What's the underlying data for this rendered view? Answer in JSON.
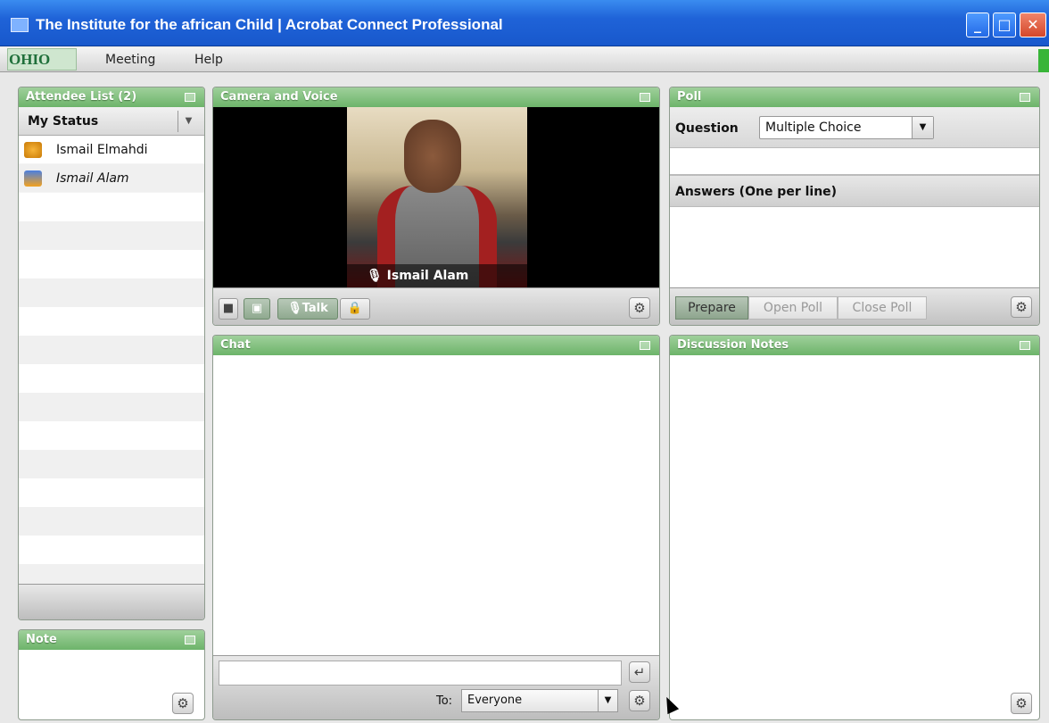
{
  "window": {
    "title": "The Institute for the african Child | Acrobat Connect Professional",
    "minimize": "_",
    "maximize": "□",
    "close": "✕"
  },
  "menubar": {
    "brand": "OHIO",
    "items": [
      {
        "label": "Meeting"
      },
      {
        "label": "Help"
      }
    ]
  },
  "attendees": {
    "title": "Attendee List (2)",
    "my_status": "My Status",
    "list": [
      {
        "name": "Ismail Elmahdi",
        "role": "host-icon"
      },
      {
        "name": "Ismail Alam",
        "role": "presenter-icon"
      }
    ]
  },
  "note": {
    "title": "Note"
  },
  "camera": {
    "title": "Camera and Voice",
    "speaker": "Ismail Alam",
    "talk_label": "Talk"
  },
  "poll": {
    "title": "Poll",
    "question_label": "Question",
    "type": "Multiple Choice",
    "answers_label": "Answers (One per line)",
    "buttons": [
      "Prepare",
      "Open Poll",
      "Close Poll"
    ]
  },
  "chat": {
    "title": "Chat",
    "to_label": "To:",
    "recipient": "Everyone"
  },
  "notes": {
    "title": "Discussion Notes"
  },
  "colors": {
    "titlebar": "#1f63d8",
    "panel_header": "#6db46a"
  }
}
